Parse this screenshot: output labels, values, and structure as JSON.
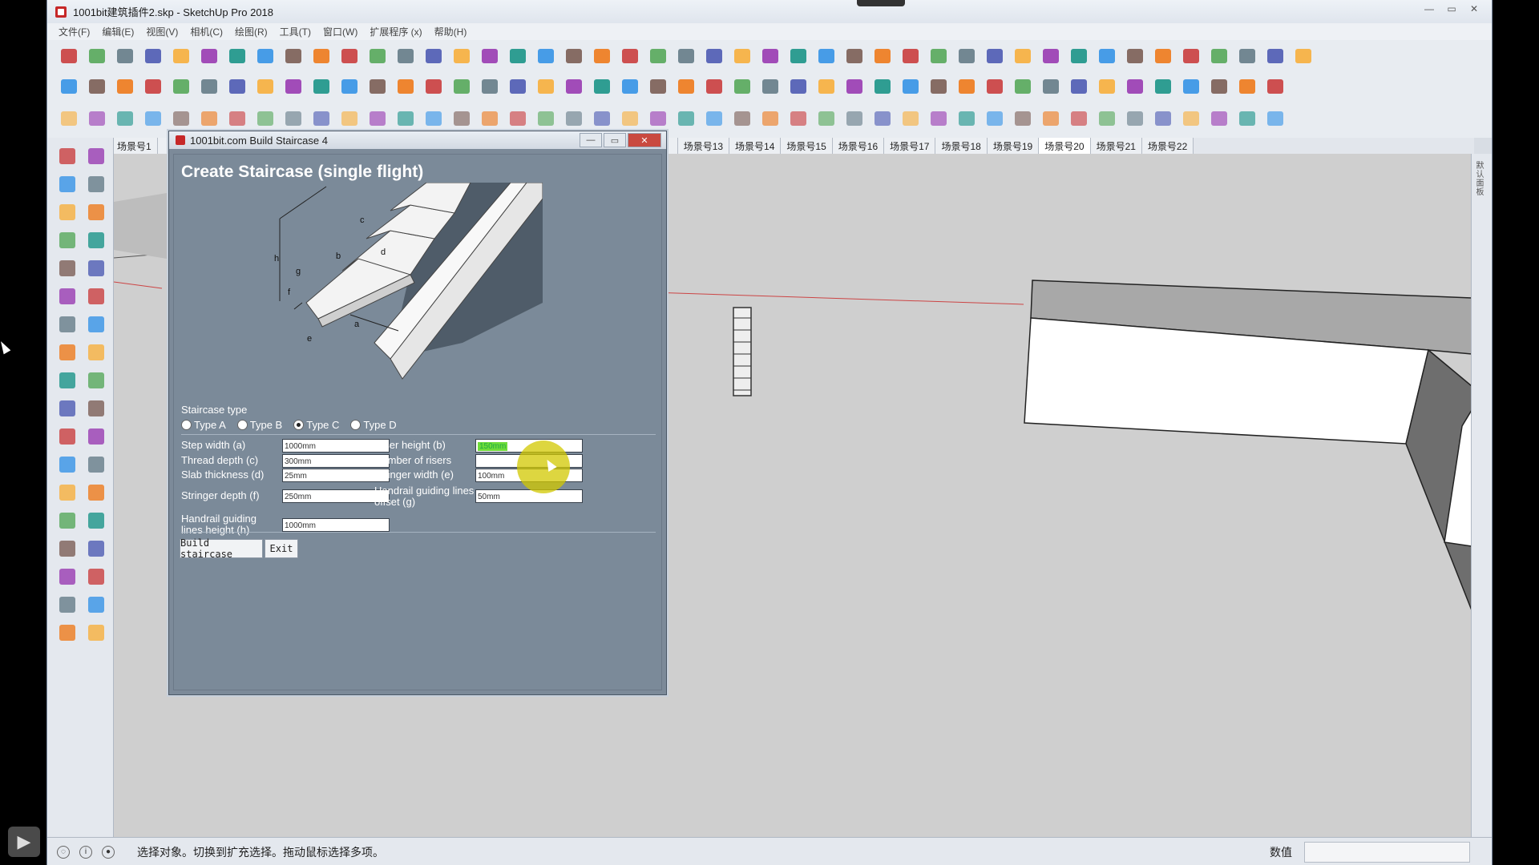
{
  "window": {
    "title": "1001bit建筑插件2.skp - SketchUp Pro 2018",
    "controls": [
      "—",
      "▭",
      "✕"
    ]
  },
  "menu": [
    "文件(F)",
    "编辑(E)",
    "视图(V)",
    "相机(C)",
    "绘图(R)",
    "工具(T)",
    "窗口(W)",
    "扩展程序 (x)",
    "帮助(H)"
  ],
  "scene_tabs": {
    "items": [
      "场景号1",
      "",
      "",
      "",
      "",
      "",
      "",
      "",
      "",
      "",
      "",
      "",
      "场景号13",
      "场景号14",
      "场景号15",
      "场景号16",
      "场景号17",
      "场景号18",
      "场景号19",
      "场景号20",
      "场景号21",
      "场景号22"
    ],
    "active_index": 19
  },
  "dialog": {
    "window_title": "1001bit.com Build Staircase 4",
    "heading": "Create Staircase (single flight)",
    "staircase_type_label": "Staircase type",
    "types": [
      "Type A",
      "Type B",
      "Type C",
      "Type D"
    ],
    "selected_type": "Type C",
    "fields": {
      "step_width_label": "Step width (a)",
      "step_width_value": "1000mm",
      "thread_depth_label": "Thread depth (c)",
      "thread_depth_value": "300mm",
      "slab_thickness_label": "Slab thickness (d)",
      "slab_thickness_value": "25mm",
      "stringer_depth_label": "Stringer depth (f)",
      "stringer_depth_value": "250mm",
      "handrail_height_label": "Handrail guiding lines height (h)",
      "handrail_height_value": "1000mm",
      "riser_height_label": "Riser height (b)",
      "riser_height_value": "150mm",
      "number_of_risers_label": "Number of risers",
      "number_of_risers_value": "",
      "stringer_width_label": "Stringer width (e)",
      "stringer_width_value": "100mm",
      "handrail_offset_label": "Handrail guiding lines offset (g)",
      "handrail_offset_value": "50mm"
    },
    "build_button": "Build staircase",
    "exit_button": "Exit",
    "diagram_labels": [
      "h",
      "c",
      "b",
      "d",
      "g",
      "f",
      "a",
      "e"
    ]
  },
  "status": {
    "text": "选择对象。切换到扩充选择。拖动鼠标选择多项。",
    "value_label": "数值"
  },
  "right_panel_label": "默认面板",
  "colors": {
    "dialog_bg": "#7c8a99",
    "viewport_bg": "#cfcfcf",
    "highlight": "#d2c800"
  }
}
